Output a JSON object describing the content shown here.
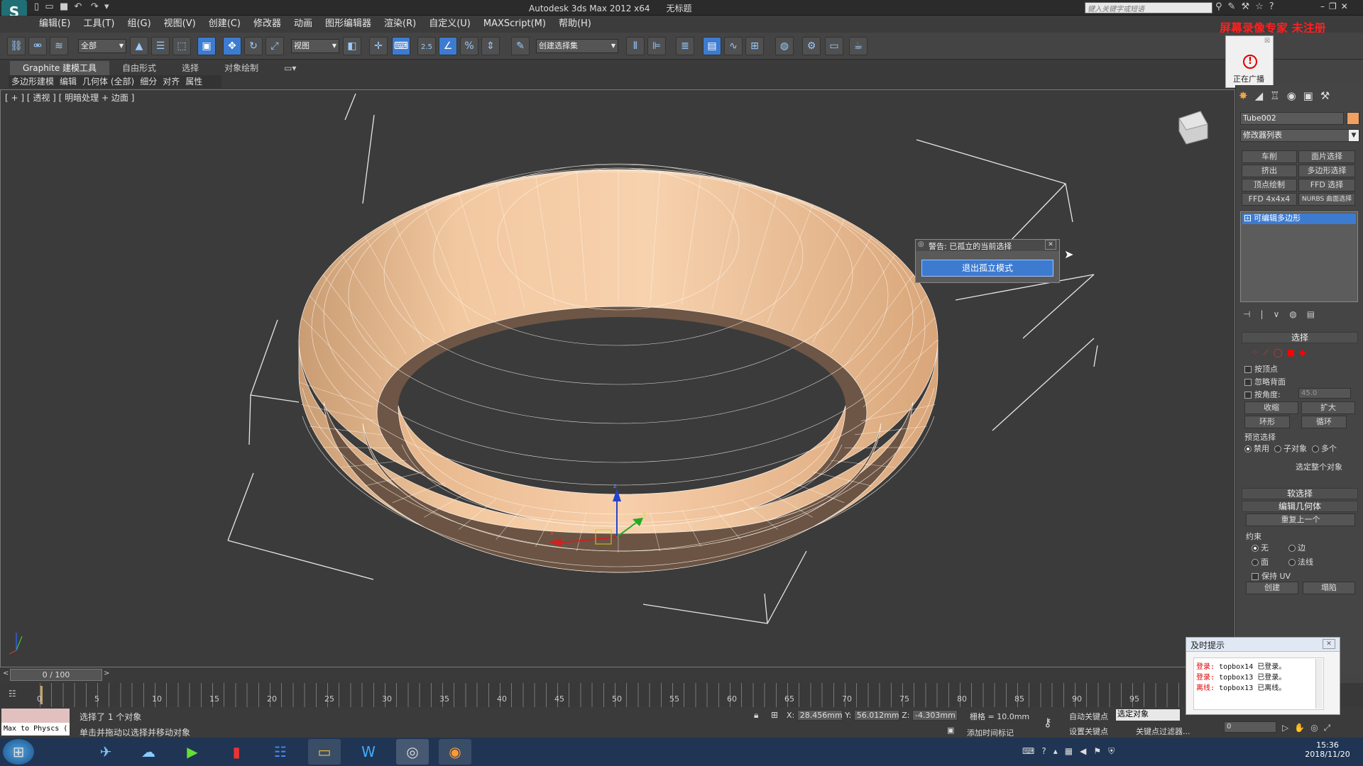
{
  "window": {
    "title": "Autodesk 3ds Max  2012 x64",
    "doc": "无标题",
    "search_placeholder": "键入关键字或短语"
  },
  "menu": [
    "编辑(E)",
    "工具(T)",
    "组(G)",
    "视图(V)",
    "创建(C)",
    "修改器",
    "动画",
    "图形编辑器",
    "渲染(R)",
    "自定义(U)",
    "MAXScript(M)",
    "帮助(H)"
  ],
  "toolbar": {
    "filter_value": "全部",
    "refcoord_value": "视图",
    "snap_angle": "2.5",
    "selset_value": "创建选择集"
  },
  "ribbon": {
    "tabs": [
      "Graphite 建模工具",
      "自由形式",
      "选择",
      "对象绘制"
    ],
    "subtabs": [
      "多边形建模",
      "编辑",
      "几何体 (全部)",
      "细分",
      "对齐",
      "属性"
    ]
  },
  "viewport": {
    "label": "[ + ] [ 透视 ] [ 明暗处理 + 边面 ]"
  },
  "isolate_dialog": {
    "title": "警告: 已孤立的当前选择",
    "button": "退出孤立模式"
  },
  "overlay_warning": "屏幕录像专家  未注册",
  "broadcast": {
    "label": "正在广播"
  },
  "cmdpanel": {
    "object_name": "Tube002",
    "modifier_list": "修改器列表",
    "mod_buttons": [
      "车削",
      "面片选择",
      "挤出",
      "多边形选择",
      "顶点绘制",
      "FFD 选择",
      "FFD 4x4x4",
      "NURBS 曲面选择"
    ],
    "stack_item": "可编辑多边形",
    "rollout_select": "选择",
    "by_vertex": "按顶点",
    "ignore_backface": "忽略背面",
    "by_angle": "按角度:",
    "angle_value": "45.0",
    "shrink": "收缩",
    "grow": "扩大",
    "ring": "环形",
    "loop": "循环",
    "preview_selection": "预览选择",
    "preview_options": [
      "禁用",
      "子对象",
      "多个"
    ],
    "select_whole": "选定整个对象",
    "soft_selection": "软选择",
    "edit_geometry": "编辑几何体",
    "repeat_last": "重复上一个",
    "constraints": "约束",
    "constraint_options": [
      "无",
      "边",
      "面",
      "法线"
    ],
    "preserve_uv": "保持 UV",
    "create": "创建",
    "collapse": "塌陷"
  },
  "timeline": {
    "frame": "0 / 100",
    "ticks": [
      "0",
      "5",
      "10",
      "15",
      "20",
      "25",
      "30",
      "35",
      "40",
      "45",
      "50",
      "55",
      "60",
      "65",
      "70",
      "75",
      "80",
      "85",
      "90",
      "95"
    ]
  },
  "status": {
    "maxscript": "Max to Physcs (",
    "selected": "选择了 1 个对象",
    "prompt": "单击并拖动以选择并移动对象",
    "x_label": "X:",
    "x": "28.456mm",
    "y_label": "Y:",
    "y": "56.012mm",
    "z_label": "Z:",
    "z": "-4.303mm",
    "grid": "栅格 = 10.0mm",
    "autokey": "自动关键点",
    "setkey": "设置关键点",
    "selobj": "选定对象",
    "keyfilter": "关键点过滤器...",
    "add_time_tag": "添加时间标记",
    "frame_field": "0"
  },
  "notice": {
    "title": "及时提示",
    "lines": [
      {
        "tag": "登录:",
        "text": "topbox14 已登录。"
      },
      {
        "tag": "登录:",
        "text": "topbox13 已登录。"
      },
      {
        "tag": "离线:",
        "text": "topbox13 已离线。"
      }
    ]
  },
  "taskbar": {
    "time": "15:36",
    "date": "2018/11/20"
  },
  "colors": {
    "accent": "#3d7bd0",
    "mesh": "#f0c49a",
    "warn": "#ff2020"
  }
}
